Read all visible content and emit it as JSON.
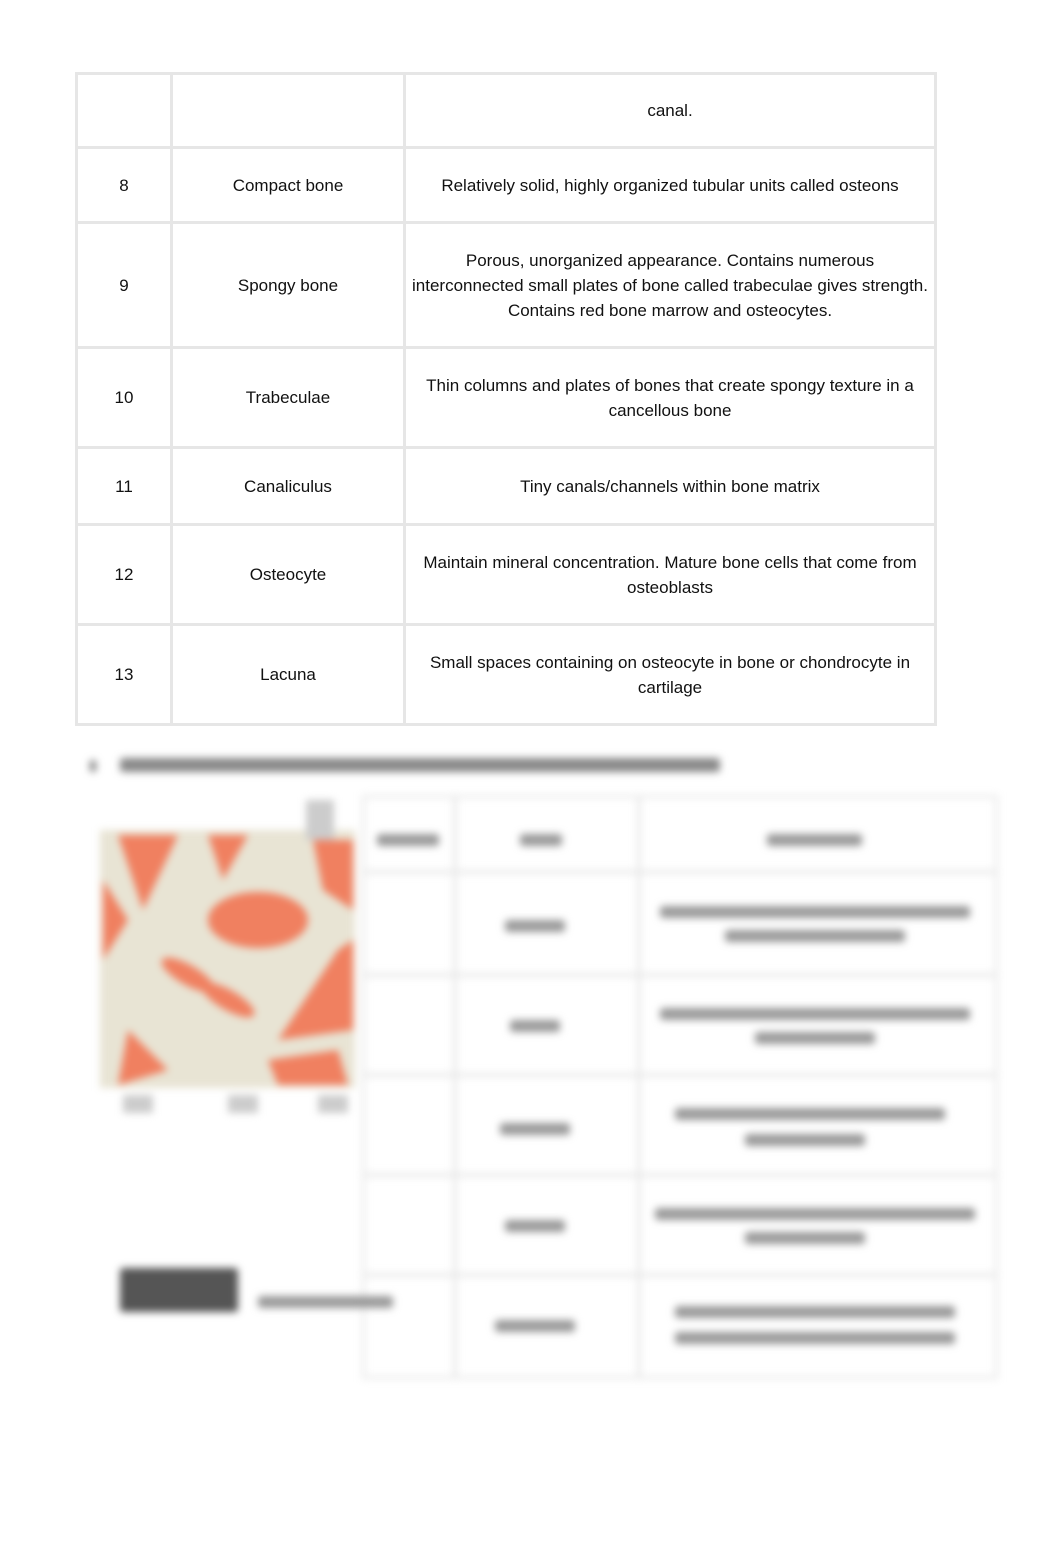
{
  "table": {
    "rows": [
      {
        "number": "",
        "term": "",
        "description": "canal."
      },
      {
        "number": "8",
        "term": "Compact bone",
        "description": "Relatively solid, highly organized tubular units called osteons"
      },
      {
        "number": "9",
        "term": "Spongy bone",
        "description": "Porous, unorganized appearance. Contains numerous interconnected small plates of bone called trabeculae gives strength. Contains red bone marrow and osteocytes."
      },
      {
        "number": "10",
        "term": "Trabeculae",
        "description": "Thin columns and plates of bones that create spongy texture in a cancellous bone"
      },
      {
        "number": "11",
        "term": "Canaliculus",
        "description": "Tiny canals/channels within bone matrix"
      },
      {
        "number": "12",
        "term": "Osteocyte",
        "description": "Maintain mineral concentration. Mature bone cells that come from osteoblasts"
      },
      {
        "number": "13",
        "term": "Lacuna",
        "description": "Small spaces containing on osteocyte in bone or chondrocyte in cartilage"
      }
    ]
  },
  "colors": {
    "marrow": "#f08060",
    "bone": "#e8e4d4",
    "border": "#e6e6e6"
  }
}
